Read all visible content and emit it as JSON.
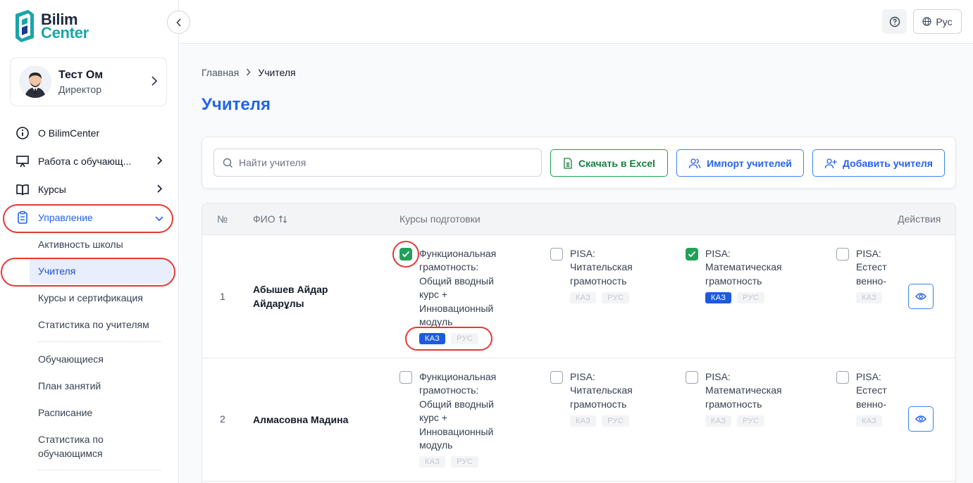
{
  "logo": {
    "line1": "Bilim",
    "line2": "Center"
  },
  "profile": {
    "name": "Тест Ом",
    "role": "Директор"
  },
  "sidebar": {
    "items": [
      {
        "label": "О BilimCenter"
      },
      {
        "label": "Работа с обучающ..."
      },
      {
        "label": "Курсы"
      },
      {
        "label": "Управление"
      }
    ],
    "sub_items": [
      "Активность школы",
      "Учителя",
      "Курсы и сертификация",
      "Статистика по учителям",
      "Обучающиеся",
      "План занятий",
      "Расписание",
      "Статистика по обучающимся"
    ]
  },
  "header": {
    "language": "Рус"
  },
  "breadcrumb": {
    "home": "Главная",
    "current": "Учителя"
  },
  "page_title": "Учителя",
  "toolbar": {
    "search_placeholder": "Найти учителя",
    "excel_label": "Скачать в Excel",
    "import_label": "Импорт учителей",
    "add_label": "Добавить учителя"
  },
  "table": {
    "headers": {
      "num": "№",
      "name": "ФИО",
      "courses": "Курсы подготовки",
      "actions": "Действия"
    },
    "tag_kaz": "КАЗ",
    "tag_rus": "РУС",
    "courses": [
      "Функциональная грамотность: Общий вводный курс + Инновационный модуль",
      "PISA: Читательская грамотность",
      "PISA: Математическая грамотность",
      "PISA: Естественно-научная грамотность"
    ],
    "rows": [
      {
        "num": "1",
        "name": "Абышев Айдар Айдарұлы",
        "courses": [
          {
            "checked": true,
            "kaz": true,
            "rus": false
          },
          {
            "checked": false,
            "kaz": false,
            "rus": false
          },
          {
            "checked": true,
            "kaz": true,
            "rus": false
          },
          {
            "checked": false,
            "kaz": false,
            "rus": false
          }
        ]
      },
      {
        "num": "2",
        "name": "Алмасовна Мадина",
        "courses": [
          {
            "checked": false,
            "kaz": false,
            "rus": false
          },
          {
            "checked": false,
            "kaz": false,
            "rus": false
          },
          {
            "checked": false,
            "kaz": false,
            "rus": false
          },
          {
            "checked": false,
            "kaz": false,
            "rus": false
          }
        ]
      }
    ]
  },
  "colors": {
    "accent": "#2563eb",
    "green": "#22a05a",
    "highlight": "#e53935"
  }
}
